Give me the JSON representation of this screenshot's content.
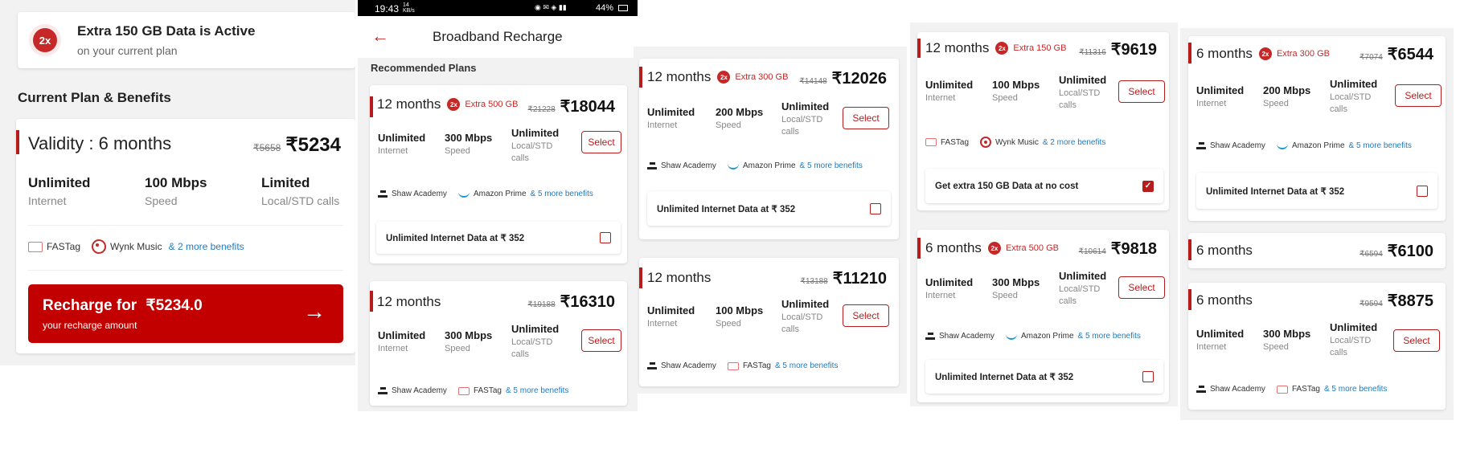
{
  "panel1": {
    "active_banner": {
      "badge": "2x",
      "title": "Extra 150 GB Data is Active",
      "subtitle": "on your current plan"
    },
    "section_title": "Current Plan & Benefits",
    "plan": {
      "validity": "Validity : 6 months",
      "old_price": "₹5658",
      "price": "₹5234",
      "stats": [
        {
          "value": "Unlimited",
          "label": "Internet"
        },
        {
          "value": "100 Mbps",
          "label": "Speed"
        },
        {
          "value": "Limited",
          "label": "Local/STD calls"
        }
      ],
      "benefits": {
        "b1": "FASTag",
        "b2": "Wynk Music",
        "more": "& 2 more benefits"
      }
    },
    "recharge": {
      "label": "Recharge for",
      "amount": "₹5234.0",
      "sub": "your recharge amount",
      "arrow": "→"
    }
  },
  "panel2": {
    "status_bar": {
      "time": "19:43",
      "data_rate": "14 KB/s",
      "battery": "44%"
    },
    "header_title": "Broadband Recharge",
    "back_icon": "←",
    "section": "Recommended Plans",
    "cards": [
      {
        "duration": "12 months",
        "extra": "Extra 500 GB",
        "old": "₹21228",
        "price": "₹18044",
        "stats": [
          {
            "value": "Unlimited",
            "label": "Internet"
          },
          {
            "value": "300 Mbps",
            "label": "Speed"
          },
          {
            "value": "Unlimited",
            "label": "Local/STD calls"
          }
        ],
        "select": "Select",
        "b1": "Shaw Academy",
        "b2": "Amazon Prime",
        "more": "& 5 more benefits"
      },
      {
        "duration": "12 months",
        "old": "₹19188",
        "price": "₹16310",
        "stats": [
          {
            "value": "Unlimited",
            "label": "Internet"
          },
          {
            "value": "300 Mbps",
            "label": "Speed"
          },
          {
            "value": "Unlimited",
            "label": "Local/STD calls"
          }
        ],
        "select": "Select",
        "b1": "Shaw Academy",
        "b2": "FASTag",
        "more": "& 5 more benefits"
      }
    ],
    "addon": "Unlimited Internet Data at ₹ 352"
  },
  "panel3": {
    "cards": [
      {
        "duration": "12 months",
        "extra": "Extra 300 GB",
        "old": "₹14148",
        "price": "₹12026",
        "stats": [
          {
            "value": "Unlimited",
            "label": "Internet"
          },
          {
            "value": "200 Mbps",
            "label": "Speed"
          },
          {
            "value": "Unlimited",
            "label": "Local/STD calls"
          }
        ],
        "select": "Select",
        "b1": "Shaw Academy",
        "b2": "Amazon Prime",
        "more": "& 5 more benefits"
      },
      {
        "duration": "12 months",
        "old": "₹13188",
        "price": "₹11210",
        "stats": [
          {
            "value": "Unlimited",
            "label": "Internet"
          },
          {
            "value": "100 Mbps",
            "label": "Speed"
          },
          {
            "value": "Unlimited",
            "label": "Local/STD calls"
          }
        ],
        "select": "Select",
        "b1": "Shaw Academy",
        "b2": "FASTag",
        "more": "& 5 more benefits"
      }
    ],
    "addon": "Unlimited Internet Data at ₹ 352"
  },
  "panel4": {
    "cards": [
      {
        "duration": "12 months",
        "extra": "Extra 150 GB",
        "old": "₹11316",
        "price": "₹9619",
        "stats": [
          {
            "value": "Unlimited",
            "label": "Internet"
          },
          {
            "value": "100 Mbps",
            "label": "Speed"
          },
          {
            "value": "Unlimited",
            "label": "Local/STD calls"
          }
        ],
        "select": "Select",
        "b1": "FASTag",
        "b2": "Wynk Music",
        "more": "& 2 more benefits"
      },
      {
        "duration": "6 months",
        "extra": "Extra 500 GB",
        "old": "₹10614",
        "price": "₹9818",
        "stats": [
          {
            "value": "Unlimited",
            "label": "Internet"
          },
          {
            "value": "300 Mbps",
            "label": "Speed"
          },
          {
            "value": "Unlimited",
            "label": "Local/STD calls"
          }
        ],
        "select": "Select",
        "b1": "Shaw Academy",
        "b2": "Amazon Prime",
        "more": "& 5 more benefits"
      }
    ],
    "addon_checked": "Get extra 150 GB Data at no cost",
    "addon": "Unlimited Internet Data at ₹ 352"
  },
  "panel5": {
    "cards": [
      {
        "duration": "6 months",
        "extra": "Extra 300 GB",
        "old": "₹7074",
        "price": "₹6544",
        "stats": [
          {
            "value": "Unlimited",
            "label": "Internet"
          },
          {
            "value": "200 Mbps",
            "label": "Speed"
          },
          {
            "value": "Unlimited",
            "label": "Local/STD calls"
          }
        ],
        "select": "Select",
        "b1": "Shaw Academy",
        "b2": "Amazon Prime",
        "more": "& 5 more benefits"
      },
      {
        "duration": "6 months",
        "old": "₹6594",
        "price": "₹6100"
      },
      {
        "duration": "6 months",
        "old": "₹9594",
        "price": "₹8875",
        "stats": [
          {
            "value": "Unlimited",
            "label": "Internet"
          },
          {
            "value": "300 Mbps",
            "label": "Speed"
          },
          {
            "value": "Unlimited",
            "label": "Local/STD calls"
          }
        ],
        "select": "Select",
        "b1": "Shaw Academy",
        "b2": "FASTag",
        "more": "& 5 more benefits"
      }
    ],
    "addon": "Unlimited Internet Data at ₹ 352"
  },
  "colors": {
    "accent": "#b71c1c",
    "link": "#1f7bbf",
    "background": "#f2f2f2"
  }
}
